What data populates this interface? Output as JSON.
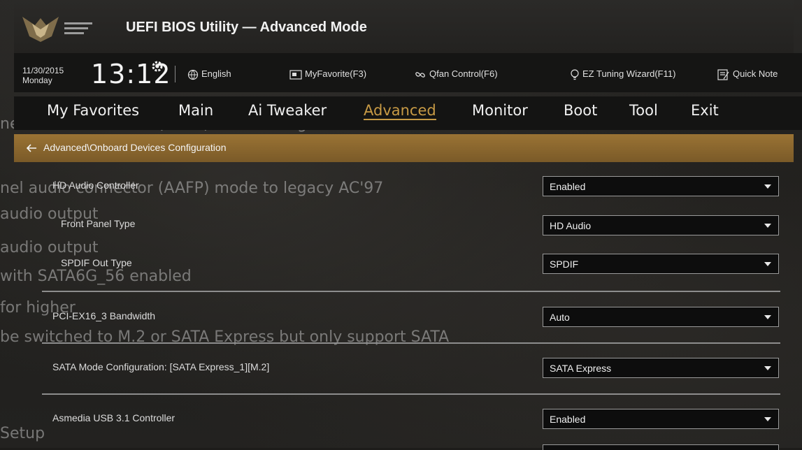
{
  "app": {
    "title": "UEFI BIOS Utility — Advanced Mode"
  },
  "status": {
    "date": "11/30/2015",
    "day": "Monday",
    "time": "13:12",
    "tools": [
      {
        "label": "English",
        "icon": "globe-icon"
      },
      {
        "label": "MyFavorite(F3)",
        "icon": "favorite-icon"
      },
      {
        "label": "Qfan Control(F6)",
        "icon": "fan-icon"
      },
      {
        "label": "EZ Tuning Wizard(F11)",
        "icon": "bulb-icon"
      },
      {
        "label": "Quick Note",
        "icon": "note-icon"
      }
    ]
  },
  "menu": {
    "items": [
      "My Favorites",
      "Main",
      "Ai Tweaker",
      "Advanced",
      "Monitor",
      "Boot",
      "Tool",
      "Exit"
    ],
    "active": "Advanced"
  },
  "breadcrumb": "Advanced\\Onboard Devices Configuration",
  "settings": [
    {
      "label": "HD Audio Controller",
      "value": "Enabled"
    },
    {
      "label": "Front Panel Type",
      "value": "HD Audio"
    },
    {
      "label": "SPDIF Out Type",
      "value": "SPDIF"
    },
    {
      "label": "PCI-EX16_3 Bandwidth",
      "value": "Auto"
    },
    {
      "label": "SATA Mode Configuration: [SATA Express_1][M.2]",
      "value": "SATA Express"
    },
    {
      "label": "Asmedia USB 3.1 Controller",
      "value": "Enabled"
    }
  ],
  "ghost_text": [
    "nel audio connector (AAFP) mode to high definition",
    "nel audio connector (AAFP) mode to legacy AC'97",
    "audio output",
    "audio output",
    "with SATA6G_56 enabled",
    "for higher",
    "be switched to M.2 or SATA Express but only support SATA",
    "Setup"
  ],
  "colors": {
    "accent": "#c79a45",
    "breadcrumb_bar": "#8d6a30"
  }
}
